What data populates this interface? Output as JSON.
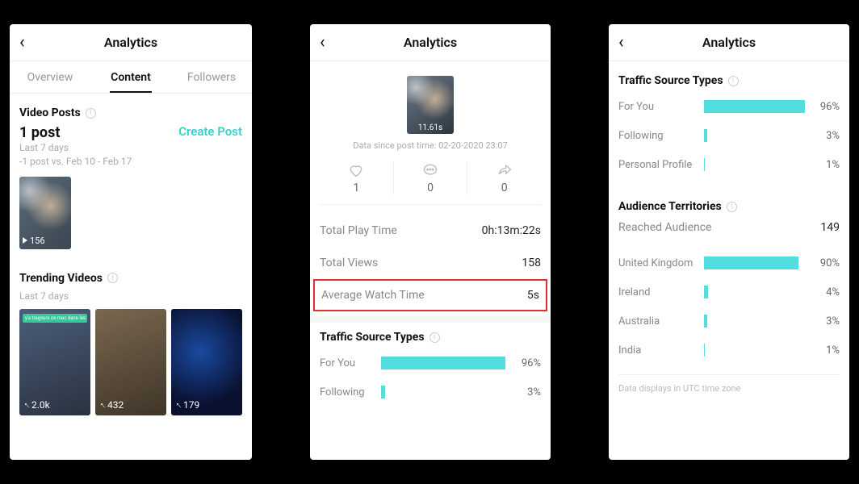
{
  "left": {
    "header": {
      "title": "Analytics"
    },
    "tabs": {
      "overview": "Overview",
      "content": "Content",
      "followers": "Followers",
      "active": "content"
    },
    "video_posts": {
      "section_title": "Video Posts",
      "count_label": "1 post",
      "create_label": "Create Post",
      "sub1": "Last 7 days",
      "sub2": "-1 post vs. Feb 10 - Feb 17",
      "thumb_count": "156"
    },
    "trending": {
      "section_title": "Trending Videos",
      "sub": "Last 7 days",
      "items": [
        {
          "count": "2.0k",
          "tag": "y'a toujours ce mec dans les trains"
        },
        {
          "count": "432"
        },
        {
          "count": "179"
        }
      ]
    }
  },
  "center": {
    "header": {
      "title": "Analytics"
    },
    "hero": {
      "duration": "11.61s"
    },
    "since": "Data since post time: 02-20-2020 23:07",
    "engagement": {
      "likes": "1",
      "comments": "0",
      "shares": "0"
    },
    "stats": {
      "total_play_time_label": "Total Play Time",
      "total_play_time": "0h:13m:22s",
      "total_views_label": "Total Views",
      "total_views": "158",
      "avg_watch_label": "Average Watch Time",
      "avg_watch": "5s"
    },
    "traffic": {
      "section_title": "Traffic Source Types",
      "items": [
        {
          "label": "For You",
          "pct_label": "96%",
          "pct": 96
        },
        {
          "label": "Following",
          "pct_label": "3%",
          "pct": 3
        }
      ]
    }
  },
  "right": {
    "header": {
      "title": "Analytics"
    },
    "traffic": {
      "section_title": "Traffic Source Types",
      "items": [
        {
          "label": "For You",
          "pct_label": "96%",
          "pct": 96
        },
        {
          "label": "Following",
          "pct_label": "3%",
          "pct": 3
        },
        {
          "label": "Personal Profile",
          "pct_label": "1%",
          "pct": 1
        }
      ]
    },
    "territories": {
      "section_title": "Audience Territories",
      "reached_label": "Reached Audience",
      "reached_value": "149",
      "items": [
        {
          "label": "United Kingdom",
          "pct_label": "90%",
          "pct": 90
        },
        {
          "label": "Ireland",
          "pct_label": "4%",
          "pct": 4
        },
        {
          "label": "Australia",
          "pct_label": "3%",
          "pct": 3
        },
        {
          "label": "India",
          "pct_label": "1%",
          "pct": 1
        }
      ]
    },
    "footnote": "Data displays in UTC time zone"
  },
  "chart_data": [
    {
      "type": "bar",
      "title": "Traffic Source Types",
      "xlabel": "",
      "ylabel": "",
      "categories": [
        "For You",
        "Following",
        "Personal Profile"
      ],
      "values": [
        96,
        3,
        1
      ],
      "ylim": [
        0,
        100
      ]
    },
    {
      "type": "bar",
      "title": "Audience Territories",
      "xlabel": "",
      "ylabel": "",
      "categories": [
        "United Kingdom",
        "Ireland",
        "Australia",
        "India"
      ],
      "values": [
        90,
        4,
        3,
        1
      ],
      "ylim": [
        0,
        100
      ]
    }
  ]
}
